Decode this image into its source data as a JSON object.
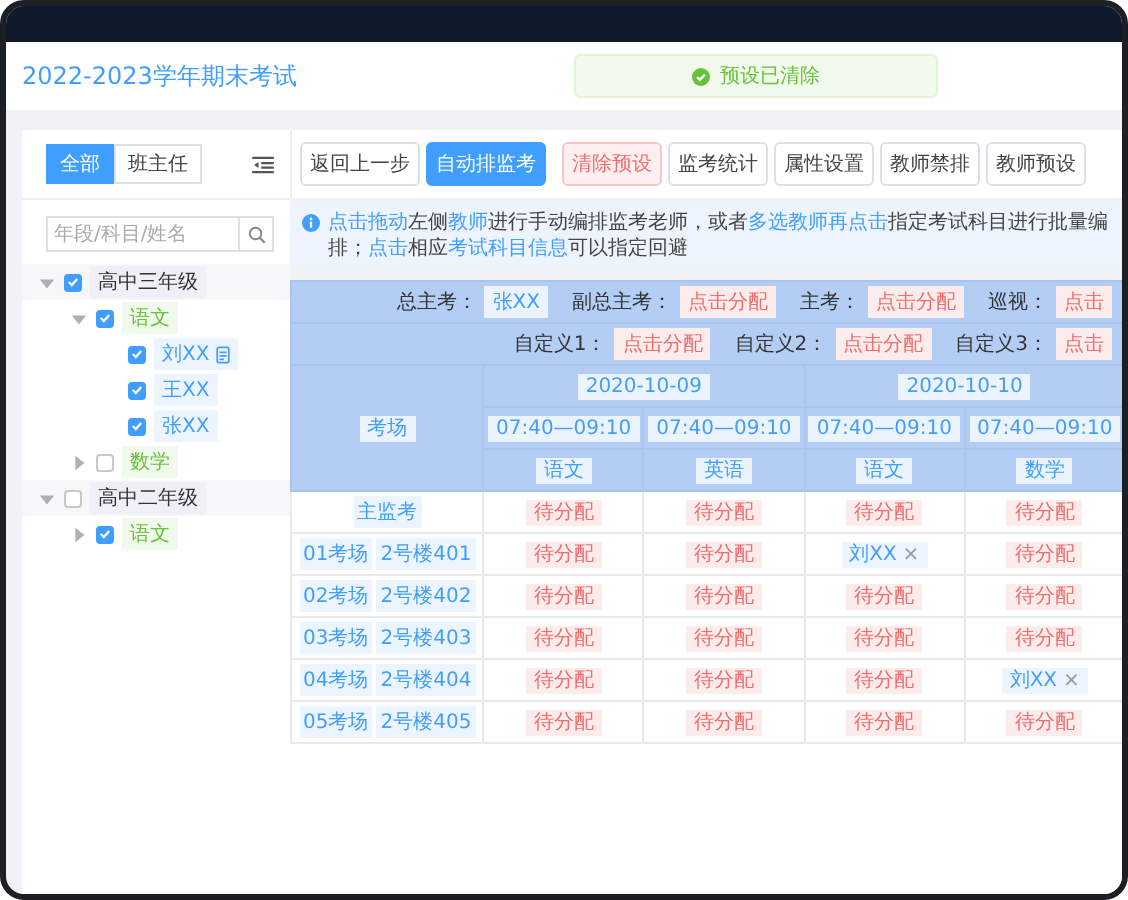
{
  "window": {
    "title": "2022-2023学年期末考试"
  },
  "toast": {
    "text": "预设已清除"
  },
  "sidebar": {
    "tabs": [
      {
        "label": "全部",
        "selected": true
      },
      {
        "label": "班主任",
        "selected": false
      }
    ],
    "search": {
      "placeholder": "年段/科目/姓名"
    },
    "tree": [
      {
        "label": "高中三年级",
        "kind": "grade",
        "expanded": true,
        "checked": true,
        "children": [
          {
            "label": "语文",
            "kind": "subject",
            "expanded": true,
            "checked": true,
            "children": [
              {
                "label": "刘XX",
                "kind": "teacher",
                "checked": true,
                "marked": true
              },
              {
                "label": "王XX",
                "kind": "teacher",
                "checked": true,
                "marked": false
              },
              {
                "label": "张XX",
                "kind": "teacher",
                "checked": true,
                "marked": false
              }
            ]
          },
          {
            "label": "数学",
            "kind": "subject",
            "expanded": false,
            "checked": false
          }
        ]
      },
      {
        "label": "高中二年级",
        "kind": "grade",
        "expanded": true,
        "checked": false,
        "children": [
          {
            "label": "语文",
            "kind": "subject",
            "expanded": false,
            "checked": true
          }
        ]
      }
    ]
  },
  "toolbar": [
    {
      "label": "返回上一步",
      "kind": "default"
    },
    {
      "label": "自动排监考",
      "kind": "primary"
    },
    {
      "label": "清除预设",
      "kind": "danger"
    },
    {
      "label": "监考统计",
      "kind": "default"
    },
    {
      "label": "属性设置",
      "kind": "default"
    },
    {
      "label": "教师禁排",
      "kind": "default"
    },
    {
      "label": "教师预设",
      "kind": "default"
    }
  ],
  "info": [
    {
      "text": "点击拖动",
      "kind": "link"
    },
    {
      "text": "左侧",
      "kind": "text"
    },
    {
      "text": "教师",
      "kind": "link"
    },
    {
      "text": "进行手动编排监考老师，或者",
      "kind": "text"
    },
    {
      "text": "多选教师再点击",
      "kind": "link"
    },
    {
      "text": "指定考试科目进行批量编排；",
      "kind": "text"
    },
    {
      "text": "点击",
      "kind": "link"
    },
    {
      "text": "相应",
      "kind": "text"
    },
    {
      "text": "考试科目信息",
      "kind": "link"
    },
    {
      "text": "可以指定回避",
      "kind": "text"
    }
  ],
  "table": {
    "staff_rows": [
      [
        {
          "label": "总主考：",
          "value": "张XX",
          "assigned": true
        },
        {
          "label": "副总主考：",
          "value": "点击分配",
          "assigned": false
        },
        {
          "label": "主考：",
          "value": "点击分配",
          "assigned": false
        },
        {
          "label": "巡视：",
          "value": "点击",
          "assigned": false
        }
      ],
      [
        {
          "label": "自定义1：",
          "value": "点击分配",
          "assigned": false
        },
        {
          "label": "自定义2：",
          "value": "点击分配",
          "assigned": false
        },
        {
          "label": "自定义3：",
          "value": "点击",
          "assigned": false
        }
      ]
    ],
    "corner": "考场",
    "dates": [
      {
        "label": "2020-10-09",
        "sessions": [
          {
            "time": "07:40—09:10",
            "subject": "语文"
          },
          {
            "time": "07:40—09:10",
            "subject": "英语"
          }
        ]
      },
      {
        "label": "2020-10-10",
        "sessions": [
          {
            "time": "07:40—09:10",
            "subject": "语文"
          },
          {
            "time": "07:40—09:10",
            "subject": "数学"
          }
        ]
      }
    ],
    "rows": [
      {
        "labels": [
          "主监考"
        ],
        "cells": [
          {
            "text": "待分配",
            "assigned": false
          },
          {
            "text": "待分配",
            "assigned": false
          },
          {
            "text": "待分配",
            "assigned": false
          },
          {
            "text": "待分配",
            "assigned": false
          }
        ]
      },
      {
        "labels": [
          "01考场",
          "2号楼401"
        ],
        "cells": [
          {
            "text": "待分配",
            "assigned": false
          },
          {
            "text": "待分配",
            "assigned": false
          },
          {
            "text": "刘XX",
            "assigned": true,
            "remove": "×"
          },
          {
            "text": "待分配",
            "assigned": false
          }
        ]
      },
      {
        "labels": [
          "02考场",
          "2号楼402"
        ],
        "cells": [
          {
            "text": "待分配",
            "assigned": false
          },
          {
            "text": "待分配",
            "assigned": false
          },
          {
            "text": "待分配",
            "assigned": false
          },
          {
            "text": "待分配",
            "assigned": false
          }
        ]
      },
      {
        "labels": [
          "03考场",
          "2号楼403"
        ],
        "cells": [
          {
            "text": "待分配",
            "assigned": false
          },
          {
            "text": "待分配",
            "assigned": false
          },
          {
            "text": "待分配",
            "assigned": false
          },
          {
            "text": "待分配",
            "assigned": false
          }
        ]
      },
      {
        "labels": [
          "04考场",
          "2号楼404"
        ],
        "cells": [
          {
            "text": "待分配",
            "assigned": false
          },
          {
            "text": "待分配",
            "assigned": false
          },
          {
            "text": "待分配",
            "assigned": false
          },
          {
            "text": "刘XX",
            "assigned": true,
            "remove": "×"
          }
        ]
      },
      {
        "labels": [
          "05考场",
          "2号楼405"
        ],
        "cells": [
          {
            "text": "待分配",
            "assigned": false
          },
          {
            "text": "待分配",
            "assigned": false
          },
          {
            "text": "待分配",
            "assigned": false
          },
          {
            "text": "待分配",
            "assigned": false
          }
        ]
      }
    ]
  }
}
